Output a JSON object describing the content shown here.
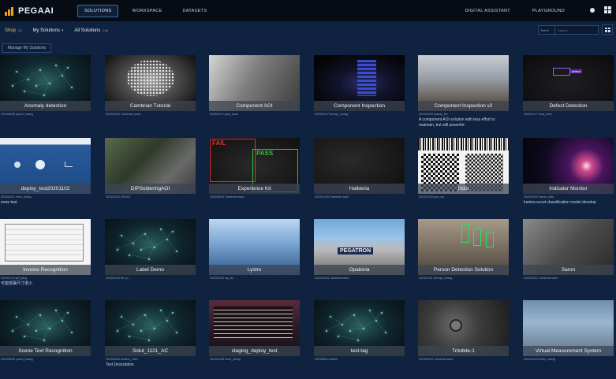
{
  "header": {
    "logo_text": "PEGAAI",
    "nav": [
      {
        "label": "SOLUTIONS",
        "active": true
      },
      {
        "label": "WORKSPACE",
        "active": false
      },
      {
        "label": "DATASETS",
        "active": false
      }
    ],
    "nav_right": [
      {
        "label": "DIGITAL ASSISTANT"
      },
      {
        "label": "PLAYGROUND"
      }
    ]
  },
  "subbar": {
    "tabs": [
      {
        "label": "Shop",
        "count": "24",
        "caret": ""
      },
      {
        "label": "My Solutions",
        "count": "",
        "caret": "▾"
      },
      {
        "label": "All Solutions",
        "count": "106",
        "caret": ""
      }
    ],
    "search_scope": "Text ▾",
    "search_placeholder": "Search"
  },
  "manage_button": "Manage My Solutions",
  "cards": [
    {
      "title": "Anomaly detection",
      "meta": "2023/08/09  yauch_huang",
      "desc": "",
      "thumb": "neural"
    },
    {
      "title": "Cambrian Tutorial",
      "meta": "2023/10/20  Cambrian_team",
      "desc": "",
      "thumb": "brain"
    },
    {
      "title": "Component AOI",
      "meta": "2023/01/17  paul_kuan",
      "desc": "",
      "thumb": "aoi"
    },
    {
      "title": "Component Inspection",
      "meta": "2023/01/17  kenny1_chang",
      "desc": "",
      "thumb": "insp"
    },
    {
      "title": "Component Inspection v2",
      "meta": "2023/03/29  mandy_lee",
      "desc": "A component AOI solution with less effort to maintain, but still powerful.",
      "thumb": "insp2"
    },
    {
      "title": "Defect Detection",
      "meta": "2023/11/17  nora_chen",
      "desc": "",
      "thumb": "defect"
    },
    {
      "title": "deploy_test20201102",
      "meta": "2023/03/11  ernie_cheng",
      "desc": "ernie test",
      "thumb": "deploy"
    },
    {
      "title": "DIPSolderingAOI",
      "meta": "2023/12/01  DR-001",
      "desc": "",
      "thumb": "pcb"
    },
    {
      "title": "Experience Kit",
      "meta": "2023/06/23  Cambrian team",
      "desc": "",
      "thumb": "exp"
    },
    {
      "title": "Halkieria",
      "meta": "2023/11/04  Cambrian team",
      "desc": "",
      "thumb": "halk"
    },
    {
      "title": "Hoto",
      "meta": "2022/11/03  yue_rao",
      "desc": "",
      "thumb": "qr"
    },
    {
      "title": "Indicator Monitor",
      "meta": "2024/02/22  steven_shih",
      "desc": "lumina scout classification model develop",
      "thumb": "indicator"
    },
    {
      "title": "Invoice Recognition",
      "meta": "2023/11/19  jeff_jiang",
      "desc": "可能部署尺寸很小",
      "thumb": "invoice"
    },
    {
      "title": "Label Demo",
      "meta": "2023/11/15  lee_tu",
      "desc": "",
      "thumb": "neural"
    },
    {
      "title": "Lystro",
      "meta": "2023/01/10  ray_liu",
      "desc": "",
      "thumb": "lystro"
    },
    {
      "title": "Opabinia",
      "meta": "2023/12/29  Cambrian team",
      "desc": "",
      "thumb": "opa"
    },
    {
      "title": "Person Detection Solution",
      "meta": "2023/11/01  kenny5_chang",
      "desc": "",
      "thumb": "person"
    },
    {
      "title": "Saron",
      "meta": "2023/12/01  Cambrian team",
      "desc": "",
      "thumb": "saron"
    },
    {
      "title": "Scene Text Recognition",
      "meta": "2023/08/09  yauch_huang",
      "desc": "",
      "thumb": "neural"
    },
    {
      "title": "Solut_1121_AC",
      "meta": "2023/04/26  andrew_chen",
      "desc": "Test Description",
      "thumb": "neural"
    },
    {
      "title": "staging_deploy_test",
      "meta": "2024/01/26  ernie_cheng",
      "desc": "",
      "thumb": "staging"
    },
    {
      "title": "test-tag",
      "meta": "2023/08/21  admin",
      "desc": "",
      "thumb": "neural"
    },
    {
      "title": "Trilobite-1",
      "meta": "2023/09/19  Cambrian team",
      "desc": "",
      "thumb": "trilo"
    },
    {
      "title": "Virtual Measurement System",
      "meta": "2023/10/13  timbo_cheng",
      "desc": "",
      "thumb": "vms"
    }
  ],
  "thumb_labels": {
    "defect_tag": "defect",
    "fail_tag": "FAIL",
    "pass_tag": "PASS",
    "opa_sign": "PEGATRON"
  }
}
